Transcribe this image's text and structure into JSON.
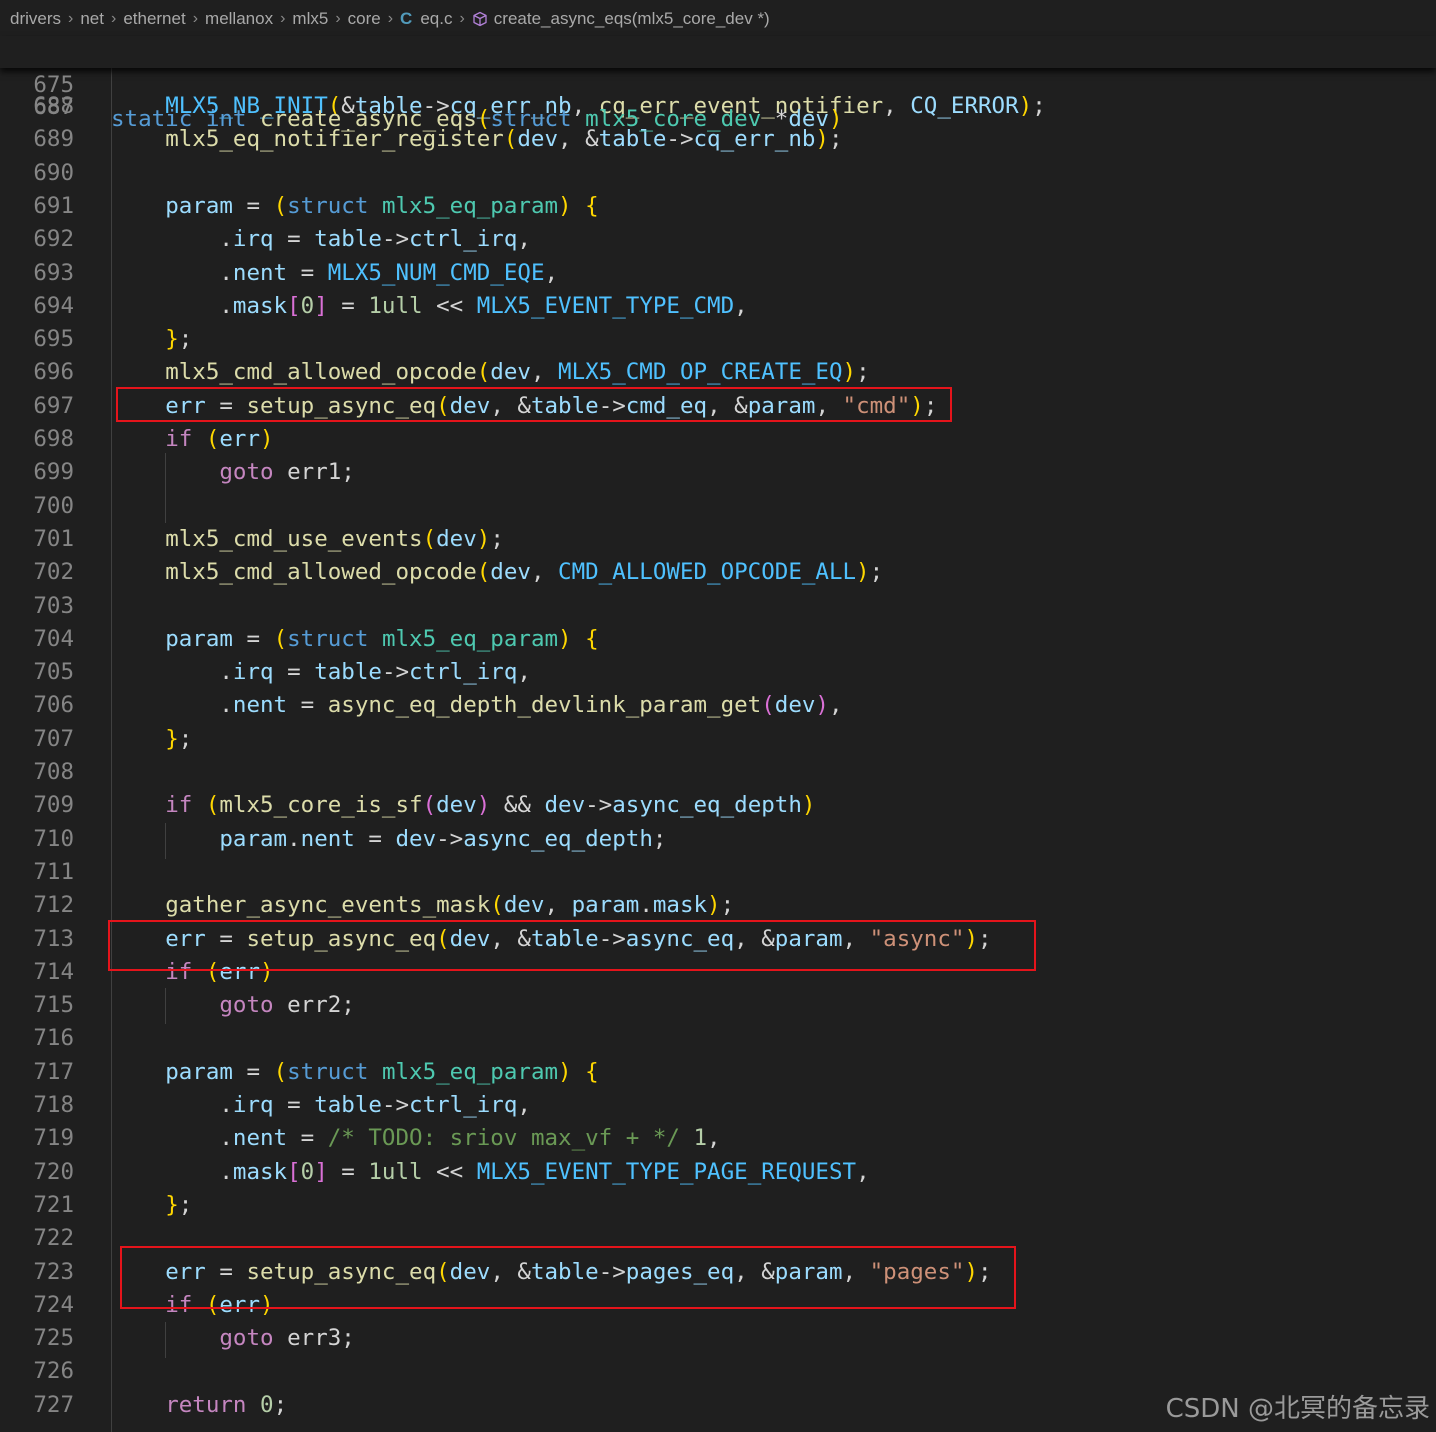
{
  "breadcrumb": {
    "items": [
      "drivers",
      "net",
      "ethernet",
      "mellanox",
      "mlx5",
      "core"
    ],
    "file": "eq.c",
    "symbol": "create_async_eqs(mlx5_core_dev *)"
  },
  "sticky_header": {
    "number": "675",
    "tokens": [
      [
        "k",
        "static"
      ],
      [
        "p",
        " "
      ],
      [
        "k",
        "int"
      ],
      [
        "p",
        " "
      ],
      [
        "f",
        "create_async_eqs"
      ],
      [
        "b1",
        "("
      ],
      [
        "k",
        "struct"
      ],
      [
        "p",
        " "
      ],
      [
        "t",
        "mlx5_core_dev"
      ],
      [
        "p",
        " *"
      ],
      [
        "v",
        "dev"
      ],
      [
        "b1",
        ")"
      ]
    ]
  },
  "partial_line_number": "687",
  "code_lines": [
    {
      "number": "688",
      "tokens": [
        [
          "p",
          "    "
        ],
        [
          "m",
          "MLX5_NB_INIT"
        ],
        [
          "b1",
          "("
        ],
        [
          "p",
          "&"
        ],
        [
          "v",
          "table"
        ],
        [
          "p",
          "->"
        ],
        [
          "v",
          "cq_err_nb"
        ],
        [
          "p",
          ", "
        ],
        [
          "f",
          "cq_err_event_notifier"
        ],
        [
          "p",
          ", "
        ],
        [
          "v",
          "CQ_ERROR"
        ],
        [
          "b1",
          ")"
        ],
        [
          "p",
          ";"
        ]
      ]
    },
    {
      "number": "689",
      "tokens": [
        [
          "p",
          "    "
        ],
        [
          "f",
          "mlx5_eq_notifier_register"
        ],
        [
          "b1",
          "("
        ],
        [
          "v",
          "dev"
        ],
        [
          "p",
          ", &"
        ],
        [
          "v",
          "table"
        ],
        [
          "p",
          "->"
        ],
        [
          "v",
          "cq_err_nb"
        ],
        [
          "b1",
          ")"
        ],
        [
          "p",
          ";"
        ]
      ]
    },
    {
      "number": "690",
      "tokens": []
    },
    {
      "number": "691",
      "tokens": [
        [
          "p",
          "    "
        ],
        [
          "v",
          "param"
        ],
        [
          "p",
          " = "
        ],
        [
          "b1",
          "("
        ],
        [
          "k",
          "struct"
        ],
        [
          "p",
          " "
        ],
        [
          "t",
          "mlx5_eq_param"
        ],
        [
          "b1",
          ")"
        ],
        [
          "p",
          " "
        ],
        [
          "b1",
          "{"
        ]
      ]
    },
    {
      "number": "692",
      "tokens": [
        [
          "p",
          "        ."
        ],
        [
          "v",
          "irq"
        ],
        [
          "p",
          " = "
        ],
        [
          "v",
          "table"
        ],
        [
          "p",
          "->"
        ],
        [
          "v",
          "ctrl_irq"
        ],
        [
          "p",
          ","
        ]
      ]
    },
    {
      "number": "693",
      "tokens": [
        [
          "p",
          "        ."
        ],
        [
          "v",
          "nent"
        ],
        [
          "p",
          " = "
        ],
        [
          "m",
          "MLX5_NUM_CMD_EQE"
        ],
        [
          "p",
          ","
        ]
      ]
    },
    {
      "number": "694",
      "tokens": [
        [
          "p",
          "        ."
        ],
        [
          "v",
          "mask"
        ],
        [
          "b2",
          "["
        ],
        [
          "n",
          "0"
        ],
        [
          "b2",
          "]"
        ],
        [
          "p",
          " = "
        ],
        [
          "n",
          "1ull"
        ],
        [
          "p",
          " << "
        ],
        [
          "m",
          "MLX5_EVENT_TYPE_CMD"
        ],
        [
          "p",
          ","
        ]
      ]
    },
    {
      "number": "695",
      "tokens": [
        [
          "p",
          "    "
        ],
        [
          "b1",
          "}"
        ],
        [
          "p",
          ";"
        ]
      ]
    },
    {
      "number": "696",
      "tokens": [
        [
          "p",
          "    "
        ],
        [
          "f",
          "mlx5_cmd_allowed_opcode"
        ],
        [
          "b1",
          "("
        ],
        [
          "v",
          "dev"
        ],
        [
          "p",
          ", "
        ],
        [
          "m",
          "MLX5_CMD_OP_CREATE_EQ"
        ],
        [
          "b1",
          ")"
        ],
        [
          "p",
          ";"
        ]
      ]
    },
    {
      "number": "697",
      "tokens": [
        [
          "p",
          "    "
        ],
        [
          "v",
          "err"
        ],
        [
          "p",
          " = "
        ],
        [
          "f",
          "setup_async_eq"
        ],
        [
          "b1",
          "("
        ],
        [
          "v",
          "dev"
        ],
        [
          "p",
          ", &"
        ],
        [
          "v",
          "table"
        ],
        [
          "p",
          "->"
        ],
        [
          "v",
          "cmd_eq"
        ],
        [
          "p",
          ", &"
        ],
        [
          "v",
          "param"
        ],
        [
          "p",
          ", "
        ],
        [
          "s",
          "\"cmd\""
        ],
        [
          "b1",
          ")"
        ],
        [
          "p",
          ";"
        ]
      ]
    },
    {
      "number": "698",
      "tokens": [
        [
          "p",
          "    "
        ],
        [
          "ctl",
          "if"
        ],
        [
          "p",
          " "
        ],
        [
          "b1",
          "("
        ],
        [
          "v",
          "err"
        ],
        [
          "b1",
          ")"
        ]
      ]
    },
    {
      "number": "699",
      "tokens": [
        [
          "p",
          "        "
        ],
        [
          "ctl",
          "goto"
        ],
        [
          "p",
          " err1;"
        ]
      ]
    },
    {
      "number": "700",
      "tokens": []
    },
    {
      "number": "701",
      "tokens": [
        [
          "p",
          "    "
        ],
        [
          "f",
          "mlx5_cmd_use_events"
        ],
        [
          "b1",
          "("
        ],
        [
          "v",
          "dev"
        ],
        [
          "b1",
          ")"
        ],
        [
          "p",
          ";"
        ]
      ]
    },
    {
      "number": "702",
      "tokens": [
        [
          "p",
          "    "
        ],
        [
          "f",
          "mlx5_cmd_allowed_opcode"
        ],
        [
          "b1",
          "("
        ],
        [
          "v",
          "dev"
        ],
        [
          "p",
          ", "
        ],
        [
          "m",
          "CMD_ALLOWED_OPCODE_ALL"
        ],
        [
          "b1",
          ")"
        ],
        [
          "p",
          ";"
        ]
      ]
    },
    {
      "number": "703",
      "tokens": []
    },
    {
      "number": "704",
      "tokens": [
        [
          "p",
          "    "
        ],
        [
          "v",
          "param"
        ],
        [
          "p",
          " = "
        ],
        [
          "b1",
          "("
        ],
        [
          "k",
          "struct"
        ],
        [
          "p",
          " "
        ],
        [
          "t",
          "mlx5_eq_param"
        ],
        [
          "b1",
          ")"
        ],
        [
          "p",
          " "
        ],
        [
          "b1",
          "{"
        ]
      ]
    },
    {
      "number": "705",
      "tokens": [
        [
          "p",
          "        ."
        ],
        [
          "v",
          "irq"
        ],
        [
          "p",
          " = "
        ],
        [
          "v",
          "table"
        ],
        [
          "p",
          "->"
        ],
        [
          "v",
          "ctrl_irq"
        ],
        [
          "p",
          ","
        ]
      ]
    },
    {
      "number": "706",
      "tokens": [
        [
          "p",
          "        ."
        ],
        [
          "v",
          "nent"
        ],
        [
          "p",
          " = "
        ],
        [
          "f",
          "async_eq_depth_devlink_param_get"
        ],
        [
          "b2",
          "("
        ],
        [
          "v",
          "dev"
        ],
        [
          "b2",
          ")"
        ],
        [
          "p",
          ","
        ]
      ]
    },
    {
      "number": "707",
      "tokens": [
        [
          "p",
          "    "
        ],
        [
          "b1",
          "}"
        ],
        [
          "p",
          ";"
        ]
      ]
    },
    {
      "number": "708",
      "tokens": []
    },
    {
      "number": "709",
      "tokens": [
        [
          "p",
          "    "
        ],
        [
          "ctl",
          "if"
        ],
        [
          "p",
          " "
        ],
        [
          "b1",
          "("
        ],
        [
          "f",
          "mlx5_core_is_sf"
        ],
        [
          "b2",
          "("
        ],
        [
          "v",
          "dev"
        ],
        [
          "b2",
          ")"
        ],
        [
          "p",
          " && "
        ],
        [
          "v",
          "dev"
        ],
        [
          "p",
          "->"
        ],
        [
          "v",
          "async_eq_depth"
        ],
        [
          "b1",
          ")"
        ]
      ]
    },
    {
      "number": "710",
      "tokens": [
        [
          "p",
          "        "
        ],
        [
          "v",
          "param"
        ],
        [
          "p",
          "."
        ],
        [
          "v",
          "nent"
        ],
        [
          "p",
          " = "
        ],
        [
          "v",
          "dev"
        ],
        [
          "p",
          "->"
        ],
        [
          "v",
          "async_eq_depth"
        ],
        [
          "p",
          ";"
        ]
      ]
    },
    {
      "number": "711",
      "tokens": []
    },
    {
      "number": "712",
      "tokens": [
        [
          "p",
          "    "
        ],
        [
          "f",
          "gather_async_events_mask"
        ],
        [
          "b1",
          "("
        ],
        [
          "v",
          "dev"
        ],
        [
          "p",
          ", "
        ],
        [
          "v",
          "param"
        ],
        [
          "p",
          "."
        ],
        [
          "v",
          "mask"
        ],
        [
          "b1",
          ")"
        ],
        [
          "p",
          ";"
        ]
      ]
    },
    {
      "number": "713",
      "tokens": [
        [
          "p",
          "    "
        ],
        [
          "v",
          "err"
        ],
        [
          "p",
          " = "
        ],
        [
          "f",
          "setup_async_eq"
        ],
        [
          "b1",
          "("
        ],
        [
          "v",
          "dev"
        ],
        [
          "p",
          ", &"
        ],
        [
          "v",
          "table"
        ],
        [
          "p",
          "->"
        ],
        [
          "v",
          "async_eq"
        ],
        [
          "p",
          ", &"
        ],
        [
          "v",
          "param"
        ],
        [
          "p",
          ", "
        ],
        [
          "s",
          "\"async\""
        ],
        [
          "b1",
          ")"
        ],
        [
          "p",
          ";"
        ]
      ]
    },
    {
      "number": "714",
      "tokens": [
        [
          "p",
          "    "
        ],
        [
          "ctl",
          "if"
        ],
        [
          "p",
          " "
        ],
        [
          "b1",
          "("
        ],
        [
          "v",
          "err"
        ],
        [
          "b1",
          ")"
        ]
      ]
    },
    {
      "number": "715",
      "tokens": [
        [
          "p",
          "        "
        ],
        [
          "ctl",
          "goto"
        ],
        [
          "p",
          " err2;"
        ]
      ]
    },
    {
      "number": "716",
      "tokens": []
    },
    {
      "number": "717",
      "tokens": [
        [
          "p",
          "    "
        ],
        [
          "v",
          "param"
        ],
        [
          "p",
          " = "
        ],
        [
          "b1",
          "("
        ],
        [
          "k",
          "struct"
        ],
        [
          "p",
          " "
        ],
        [
          "t",
          "mlx5_eq_param"
        ],
        [
          "b1",
          ")"
        ],
        [
          "p",
          " "
        ],
        [
          "b1",
          "{"
        ]
      ]
    },
    {
      "number": "718",
      "tokens": [
        [
          "p",
          "        ."
        ],
        [
          "v",
          "irq"
        ],
        [
          "p",
          " = "
        ],
        [
          "v",
          "table"
        ],
        [
          "p",
          "->"
        ],
        [
          "v",
          "ctrl_irq"
        ],
        [
          "p",
          ","
        ]
      ]
    },
    {
      "number": "719",
      "tokens": [
        [
          "p",
          "        ."
        ],
        [
          "v",
          "nent"
        ],
        [
          "p",
          " = "
        ],
        [
          "c",
          "/* TODO: sriov max_vf + */"
        ],
        [
          "p",
          " "
        ],
        [
          "n",
          "1"
        ],
        [
          "p",
          ","
        ]
      ]
    },
    {
      "number": "720",
      "tokens": [
        [
          "p",
          "        ."
        ],
        [
          "v",
          "mask"
        ],
        [
          "b2",
          "["
        ],
        [
          "n",
          "0"
        ],
        [
          "b2",
          "]"
        ],
        [
          "p",
          " = "
        ],
        [
          "n",
          "1ull"
        ],
        [
          "p",
          " << "
        ],
        [
          "m",
          "MLX5_EVENT_TYPE_PAGE_REQUEST"
        ],
        [
          "p",
          ","
        ]
      ]
    },
    {
      "number": "721",
      "tokens": [
        [
          "p",
          "    "
        ],
        [
          "b1",
          "}"
        ],
        [
          "p",
          ";"
        ]
      ]
    },
    {
      "number": "722",
      "tokens": []
    },
    {
      "number": "723",
      "tokens": [
        [
          "p",
          "    "
        ],
        [
          "v",
          "err"
        ],
        [
          "p",
          " = "
        ],
        [
          "f",
          "setup_async_eq"
        ],
        [
          "b1",
          "("
        ],
        [
          "v",
          "dev"
        ],
        [
          "p",
          ", &"
        ],
        [
          "v",
          "table"
        ],
        [
          "p",
          "->"
        ],
        [
          "v",
          "pages_eq"
        ],
        [
          "p",
          ", &"
        ],
        [
          "v",
          "param"
        ],
        [
          "p",
          ", "
        ],
        [
          "s",
          "\"pages\""
        ],
        [
          "b1",
          ")"
        ],
        [
          "p",
          ";"
        ]
      ]
    },
    {
      "number": "724",
      "tokens": [
        [
          "p",
          "    "
        ],
        [
          "ctl",
          "if"
        ],
        [
          "p",
          " "
        ],
        [
          "b1",
          "("
        ],
        [
          "v",
          "err"
        ],
        [
          "b1",
          ")"
        ]
      ]
    },
    {
      "number": "725",
      "tokens": [
        [
          "p",
          "        "
        ],
        [
          "ctl",
          "goto"
        ],
        [
          "p",
          " err3;"
        ]
      ]
    },
    {
      "number": "726",
      "tokens": []
    },
    {
      "number": "727",
      "tokens": [
        [
          "p",
          "    "
        ],
        [
          "ctl",
          "return"
        ],
        [
          "p",
          " "
        ],
        [
          "n",
          "0"
        ],
        [
          "p",
          ";"
        ]
      ]
    }
  ],
  "highlight_lines": [
    "697",
    "713",
    "723"
  ],
  "watermark": "CSDN @北冥的备忘录",
  "colors": {
    "background": "#1f1f1f",
    "line_number": "#858585",
    "highlight_border": "#e5141b",
    "keyword": "#569cd6",
    "type": "#4ec9b0",
    "function": "#dcdcaa",
    "variable": "#9cdcfe",
    "macro": "#4fc1ff",
    "string": "#ce9178",
    "number": "#b5cea8",
    "comment": "#6a9955",
    "control": "#c586c0"
  }
}
